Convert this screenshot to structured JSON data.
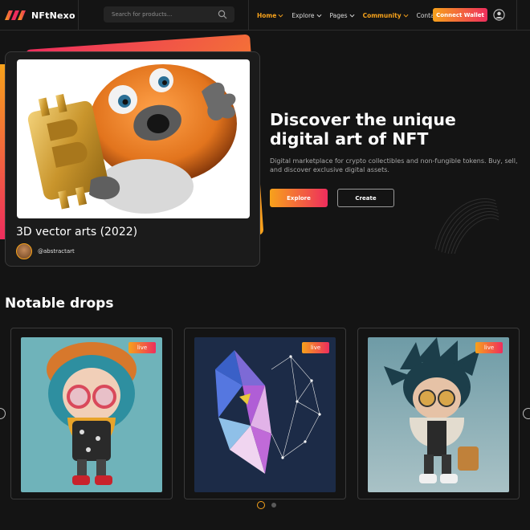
{
  "header": {
    "logo_text": "NFtNexo",
    "search_placeholder": "Search for products...",
    "nav": [
      {
        "label": "Home",
        "has_dropdown": true,
        "active": true
      },
      {
        "label": "Explore",
        "has_dropdown": true,
        "active": false
      },
      {
        "label": "Pages",
        "has_dropdown": true,
        "active": false
      },
      {
        "label": "Community",
        "has_dropdown": true,
        "active": true
      },
      {
        "label": "Contact",
        "has_dropdown": false,
        "active": false
      }
    ],
    "connect_label": "Connect Wallet"
  },
  "hero": {
    "card_title": "3D vector arts (2022)",
    "card_author": "@abstractart",
    "heading_line1": "Discover the unique",
    "heading_line2": "digital art of NFT",
    "description": "Digital marketplace for crypto collectibles and non-fungible tokens. Buy, sell, and discover exclusive digital assets.",
    "explore_label": "Explore",
    "create_label": "Create"
  },
  "drops": {
    "title": "Notable drops",
    "items": [
      {
        "badge": "live",
        "subject": "3d-girl-character"
      },
      {
        "badge": "live",
        "subject": "polygon-wolf"
      },
      {
        "badge": "live",
        "subject": "3d-boy-character"
      }
    ],
    "active_page": 1,
    "total_pages": 2
  },
  "colors": {
    "background": "#141414",
    "accent_orange": "#f7a21b",
    "accent_pink": "#ee2d5d",
    "border": "#3a3a3a"
  }
}
